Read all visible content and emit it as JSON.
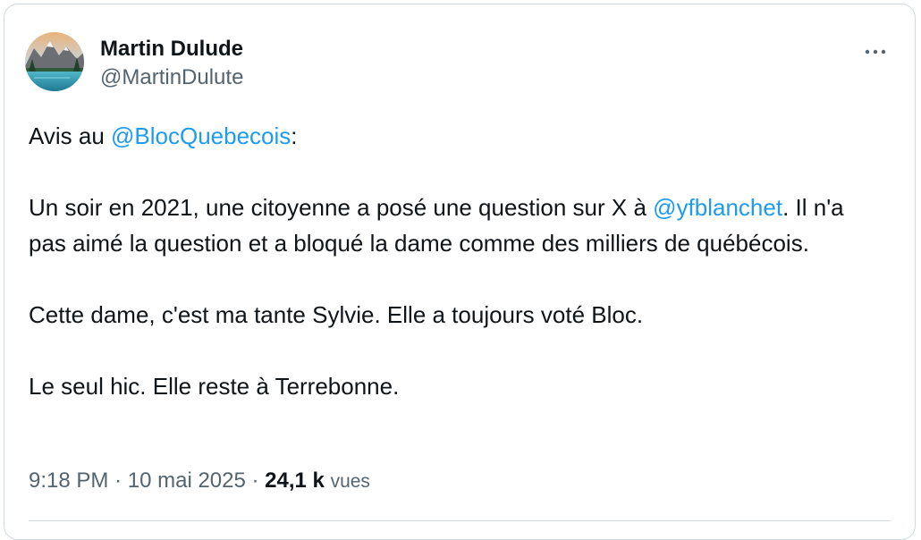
{
  "author": {
    "display_name": "Martin Dulude",
    "handle": "@MartinDulute"
  },
  "tweet": {
    "line1_prefix": "Avis au ",
    "line1_mention": "@BlocQuebecois",
    "line1_suffix": ":",
    "p2_prefix": "Un soir en 2021, une citoyenne a posé une question sur X à ",
    "p2_mention": "@yfblanchet",
    "p2_suffix": ". Il n'a pas aimé la question et a bloqué la dame comme des milliers de québécois.",
    "p3": "Cette dame, c'est ma tante Sylvie. Elle a toujours voté Bloc.",
    "p4": "Le seul hic. Elle reste à Terrebonne."
  },
  "meta": {
    "time": "9:18 PM",
    "date": "10 mai 2025",
    "separator": "·",
    "views_count": "24,1 k",
    "views_label": "vues"
  },
  "icons": {
    "more": "more-dots-icon",
    "avatar": "mountain-lake-photo"
  },
  "colors": {
    "mention": "#1d9bf0",
    "text": "#0f1419",
    "secondary": "#536471",
    "border": "#cfd9de"
  }
}
